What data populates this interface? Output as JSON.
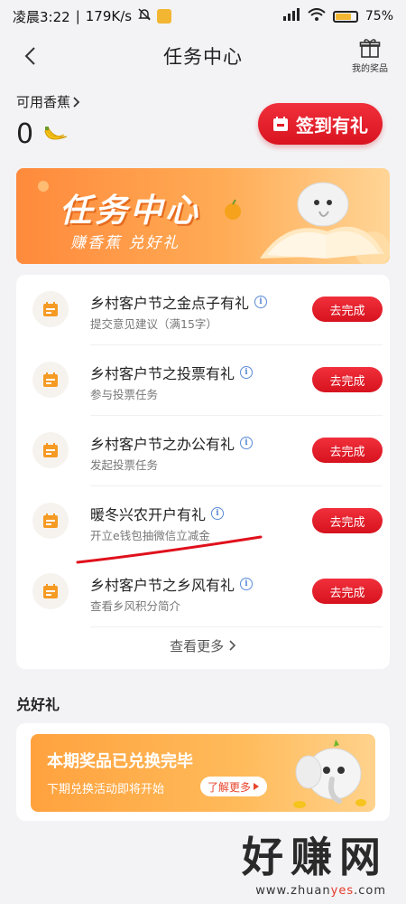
{
  "status_bar": {
    "time": "凌晨3:22",
    "speed": "179K/s",
    "battery": "75%"
  },
  "nav": {
    "title": "任务中心",
    "prizes_label": "我的奖品"
  },
  "points": {
    "label": "可用香蕉",
    "value": "0"
  },
  "signin_label": "签到有礼",
  "banner": {
    "title": "任务中心",
    "subtitle": "赚香蕉 兑好礼"
  },
  "tasks": [
    {
      "name": "乡村客户节之金点子有礼",
      "desc": "提交意见建议（满15字）",
      "button": "去完成"
    },
    {
      "name": "乡村客户节之投票有礼",
      "desc": "参与投票任务",
      "button": "去完成"
    },
    {
      "name": "乡村客户节之办公有礼",
      "desc": "发起投票任务",
      "button": "去完成"
    },
    {
      "name": "暖冬兴农开户有礼",
      "desc": "开立e钱包抽微信立减金",
      "button": "去完成"
    },
    {
      "name": "乡村客户节之乡风有礼",
      "desc": "查看乡风积分简介",
      "button": "去完成"
    }
  ],
  "more_label": "查看更多",
  "exchange": {
    "section_title": "兑好礼",
    "headline": "本期奖品已兑换完毕",
    "subline": "下期兑换活动即将开始",
    "learn_more": "了解更多"
  },
  "watermark": {
    "text": "好赚网",
    "url_prefix": "www.zhuan",
    "url_highlight": "yes",
    "url_suffix": ".com"
  },
  "colors": {
    "accent_red": "#e11a26",
    "banner_orange": "#ff9a45",
    "icon_orange": "#f59a23"
  }
}
